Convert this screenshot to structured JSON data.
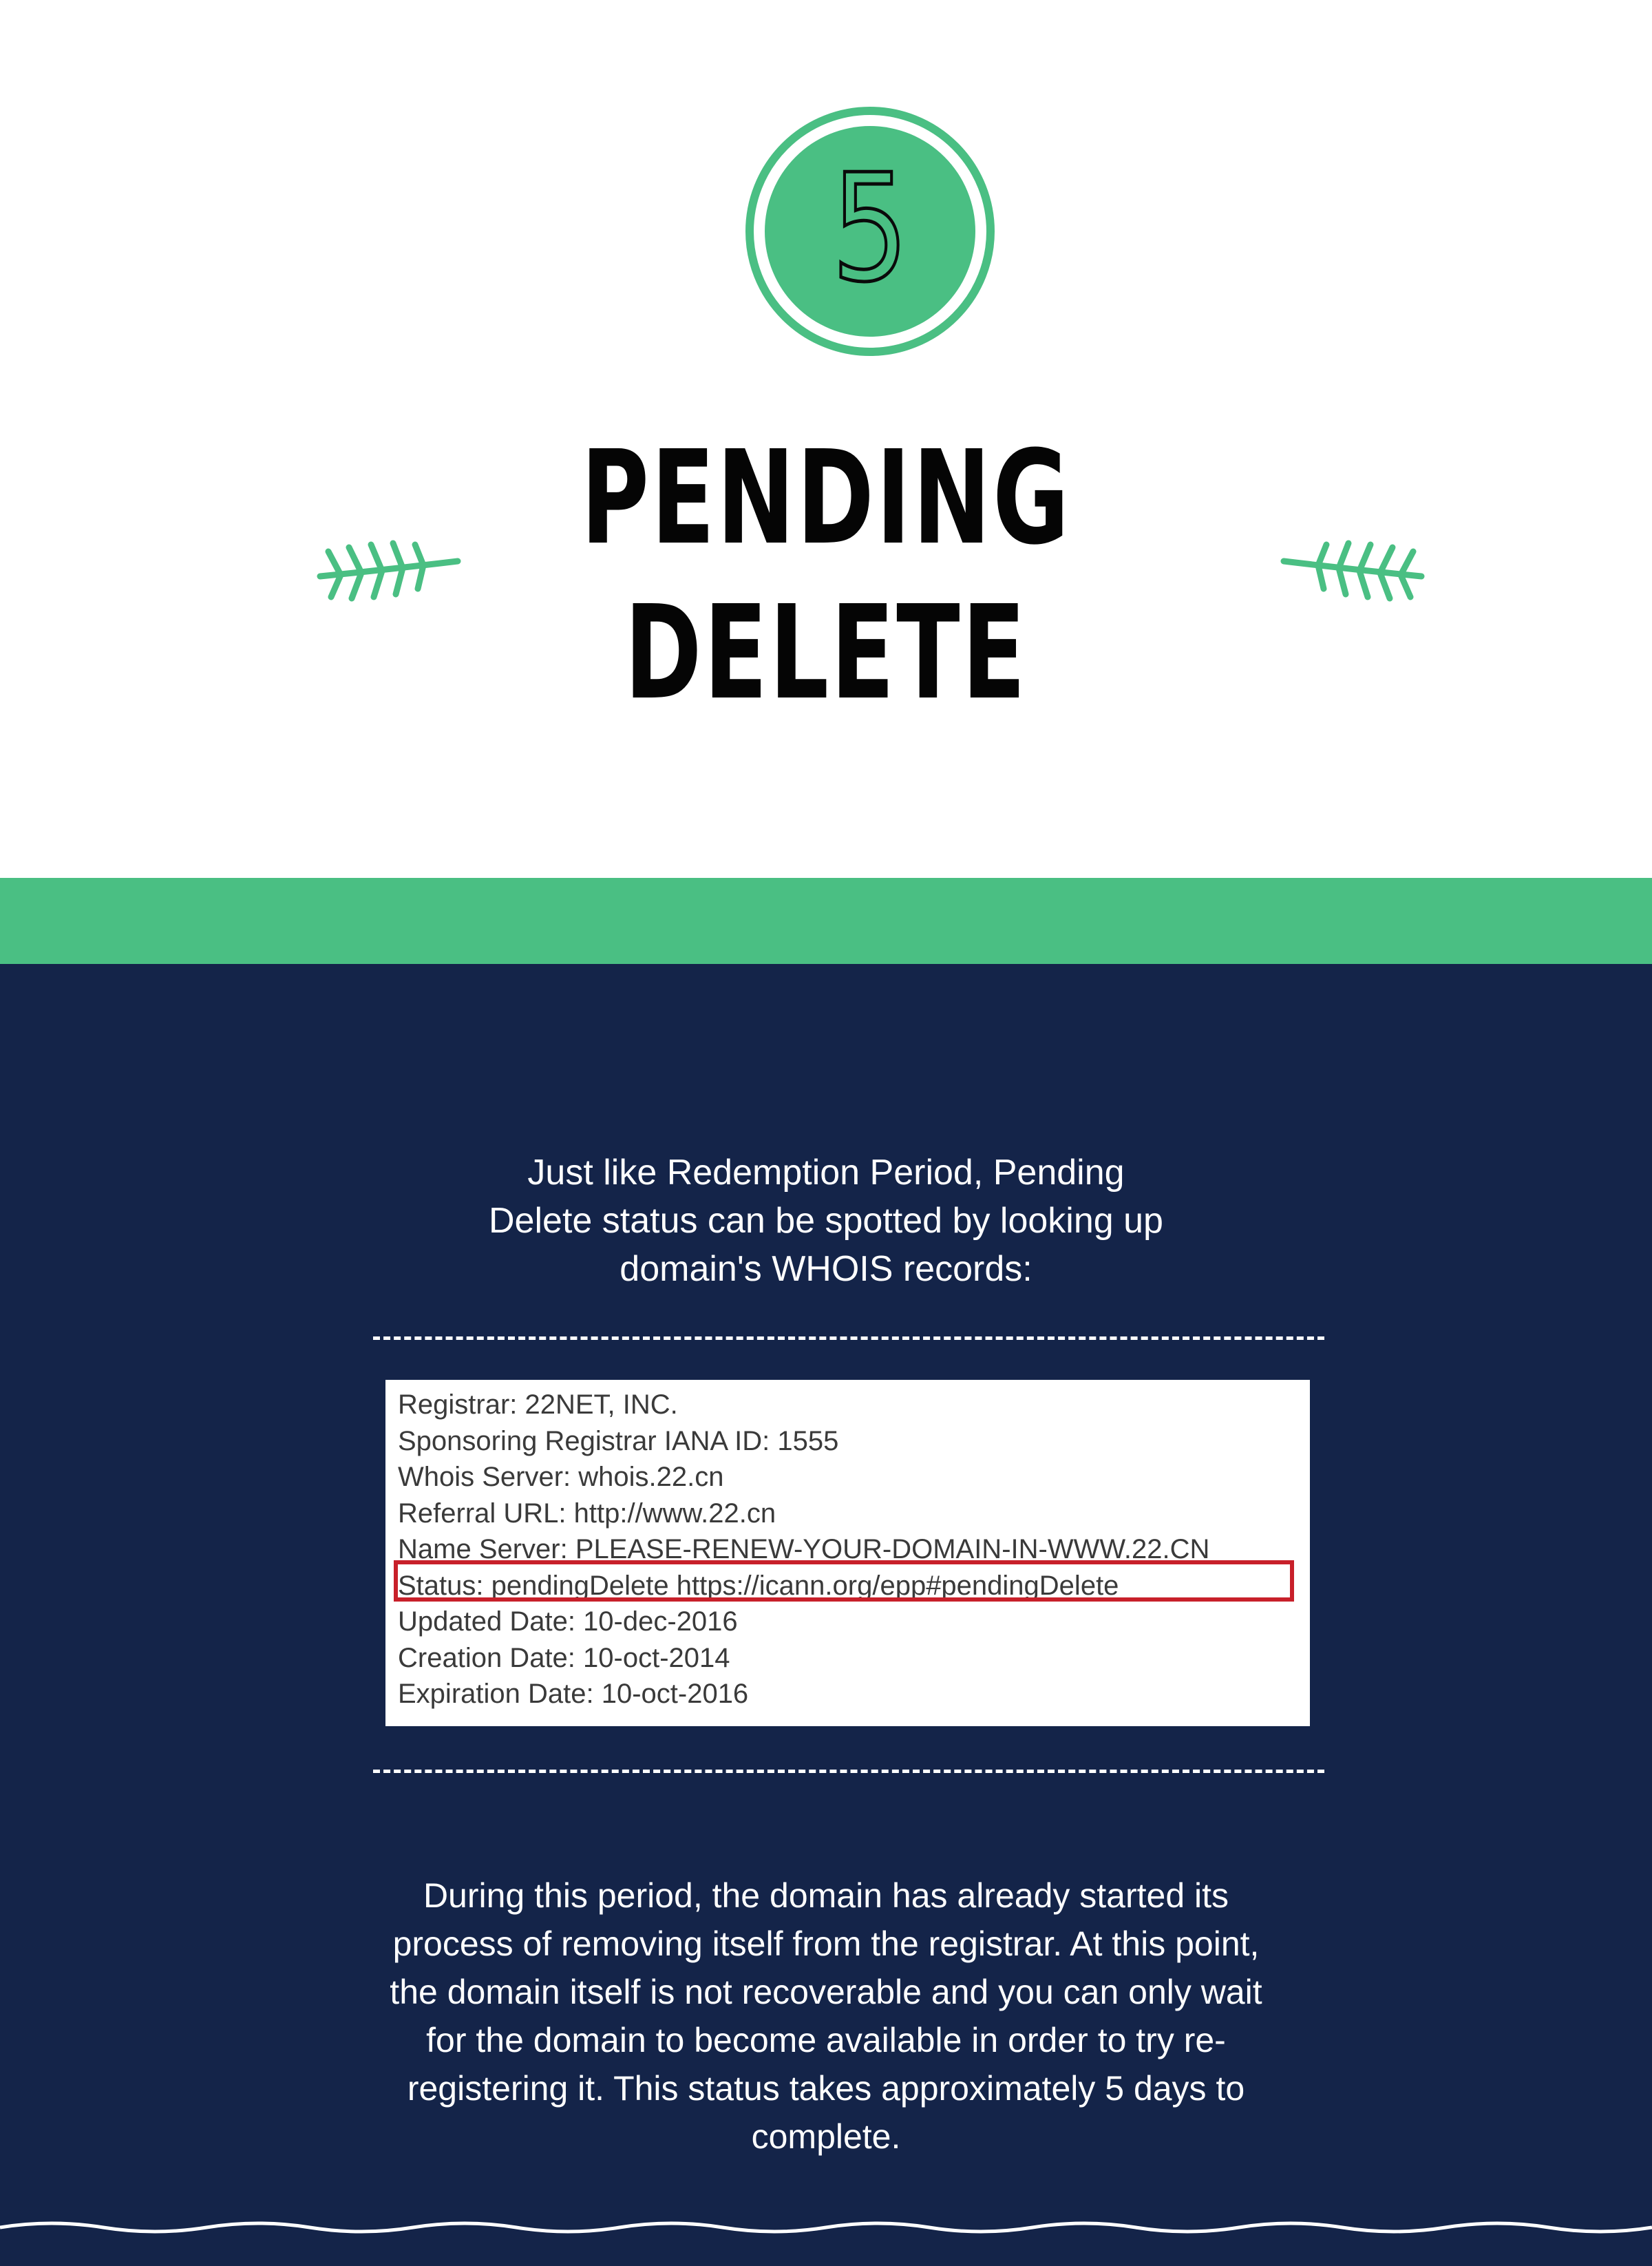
{
  "header": {
    "step_number": "5",
    "title_line1": "PENDING",
    "title_line2": "DELETE"
  },
  "intro": {
    "lines": [
      "Just like Redemption Period, Pending",
      "Delete status can be spotted by looking up",
      "domain's WHOIS records:"
    ]
  },
  "whois": {
    "lines": [
      "Registrar: 22NET, INC.",
      "Sponsoring Registrar IANA ID: 1555",
      "Whois Server: whois.22.cn",
      "Referral URL: http://www.22.cn",
      "Name Server: PLEASE-RENEW-YOUR-DOMAIN-IN-WWW.22.CN",
      "Status: pendingDelete https://icann.org/epp#pendingDelete",
      "Updated Date: 10-dec-2016",
      "Creation Date: 10-oct-2014",
      "Expiration Date: 10-oct-2016"
    ],
    "highlighted_line_index": 5
  },
  "description": {
    "lines": [
      "During this period, the domain has already started its",
      "process of removing itself from the registrar. At this point,",
      "the domain itself is not recoverable and you can only wait",
      "for the domain to become available in order to try re-",
      "registering it. This status takes approximately 5 days to",
      "complete."
    ]
  },
  "colors": {
    "accent_green": "#4ABF83",
    "navy": "#142449",
    "highlight_red": "#C8202A"
  },
  "icons": {
    "badge": "number-circle-icon",
    "decor_left": "fern-leaf-icon",
    "decor_right": "fern-leaf-icon"
  }
}
